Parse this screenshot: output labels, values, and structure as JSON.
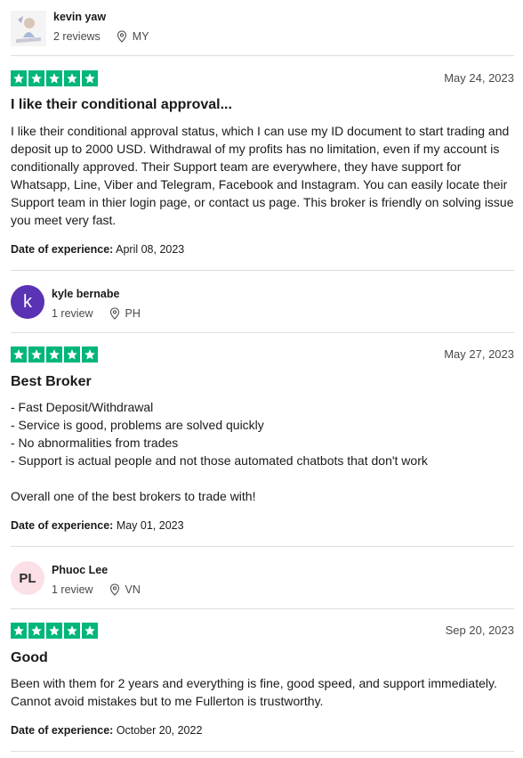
{
  "reviews": [
    {
      "reviewer": {
        "name": "kevin yaw",
        "initials": "",
        "reviews": "2 reviews",
        "country": "MY"
      },
      "rating": 5,
      "date": "May 24, 2023",
      "title": "I like their conditional approval...",
      "body": "I like their conditional approval status, which I can use my ID document to start trading and deposit up to 2000 USD. Withdrawal of my profits has no limitation, even if my account is conditionally approved. Their Support team are everywhere, they have support for Whatsapp, Line, Viber and Telegram, Facebook and Instagram. You can easily locate their Support team in thier login page, or contact us page. This broker is friendly on solving issue you meet very fast.",
      "experience_label": "Date of experience:",
      "experience_date": "April 08, 2023"
    },
    {
      "reviewer": {
        "name": "kyle bernabe",
        "initials": "k",
        "reviews": "1 review",
        "country": "PH"
      },
      "rating": 5,
      "date": "May 27, 2023",
      "title": "Best Broker",
      "body": "- Fast Deposit/Withdrawal\n- Service is good, problems are solved quickly\n- No abnormalities from trades\n- Support is actual people and not those automated chatbots that don't work\n\nOverall one of the best brokers to trade with!",
      "experience_label": "Date of experience:",
      "experience_date": "May 01, 2023"
    },
    {
      "reviewer": {
        "name": "Phuoc Lee",
        "initials": "PL",
        "reviews": "1 review",
        "country": "VN"
      },
      "rating": 5,
      "date": "Sep 20, 2023",
      "title": "Good",
      "body": "Been with them for 2 years and everything is fine, good speed, and support immediately. Cannot avoid mistakes but to me Fullerton is trustworthy.",
      "experience_label": "Date of experience:",
      "experience_date": "October 20, 2022"
    }
  ],
  "colors": {
    "star_green": "#00b67a",
    "avatar_purple": "#5a32b4",
    "avatar_pink": "#fbe0e6"
  },
  "icons": {
    "star": "star-icon",
    "location": "location-pin-icon"
  }
}
